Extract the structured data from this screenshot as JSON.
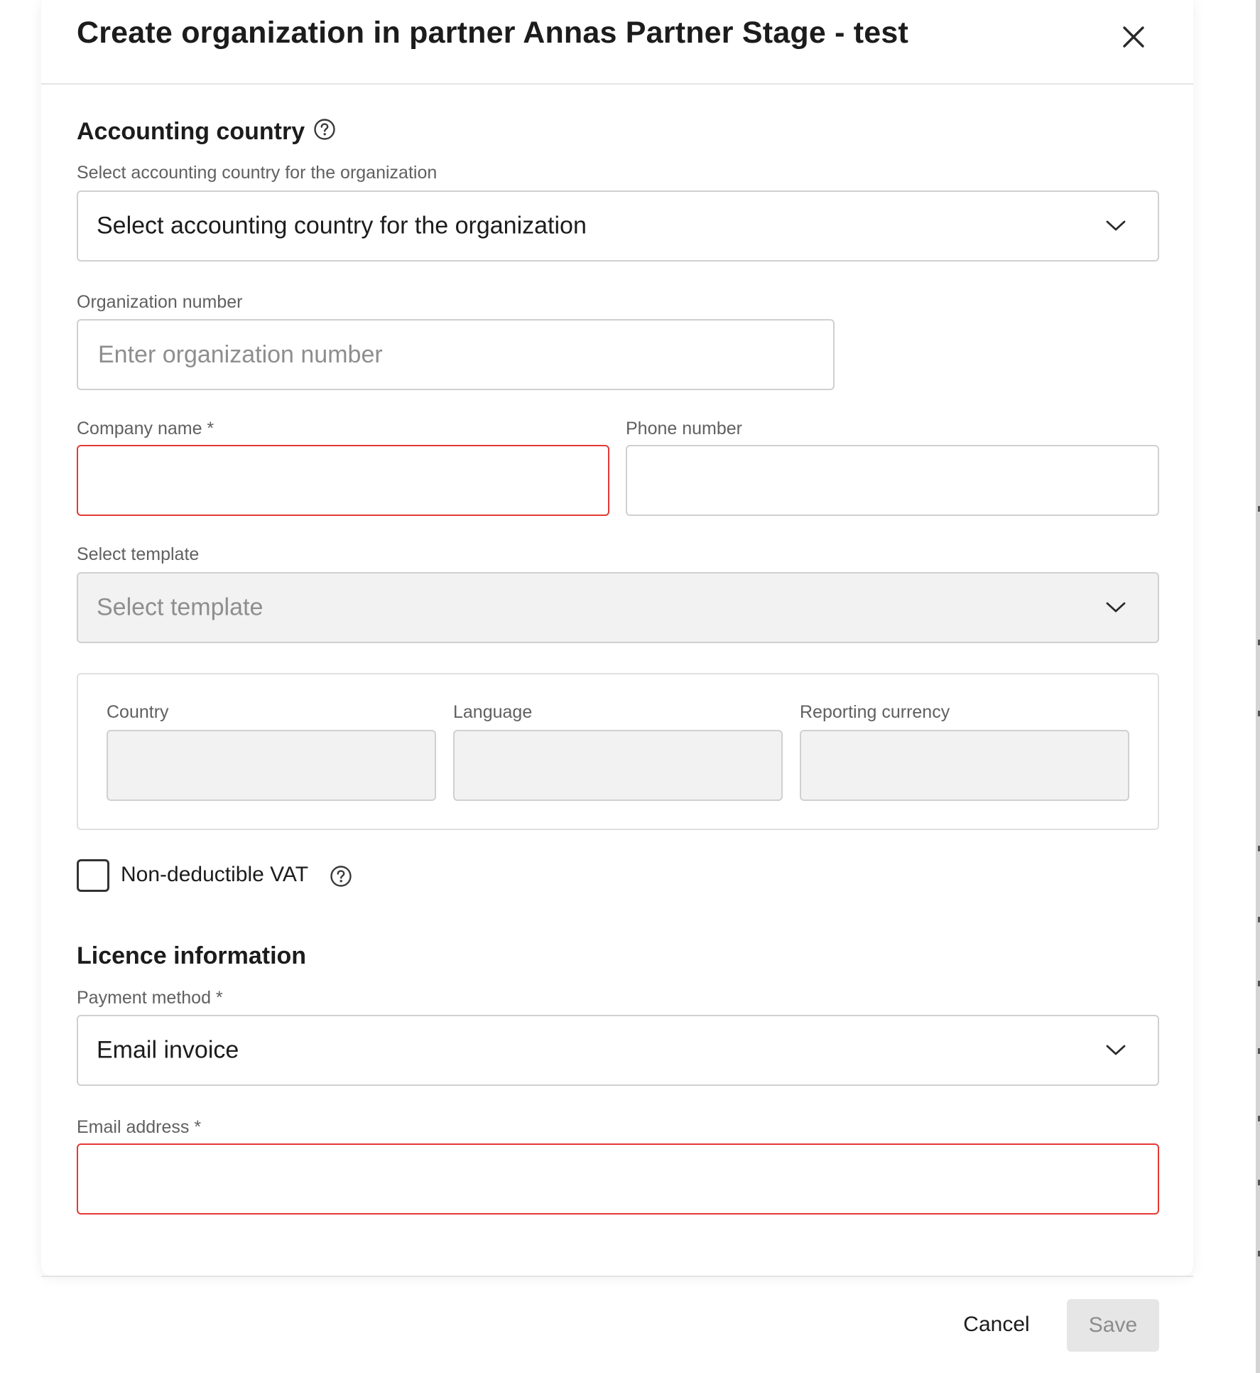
{
  "modal": {
    "title": "Create organization in partner Annas Partner Stage - test",
    "close_icon": "close-icon"
  },
  "accounting": {
    "section_title": "Accounting country",
    "help_icon": "help-circle-icon",
    "label": "Select accounting country for the organization",
    "select_value": "Select accounting country for the organization"
  },
  "org_number": {
    "label": "Organization number",
    "placeholder": "Enter organization number",
    "value": ""
  },
  "company_name": {
    "label": "Company name *",
    "value": "",
    "state": "error"
  },
  "phone_number": {
    "label": "Phone number",
    "value": ""
  },
  "template": {
    "label": "Select template",
    "placeholder": "Select template",
    "state": "disabled"
  },
  "template_details": {
    "country_label": "Country",
    "language_label": "Language",
    "currency_label": "Reporting currency"
  },
  "vat": {
    "label": "Non-deductible VAT",
    "checked": false
  },
  "licence": {
    "section_title": "Licence information",
    "payment_label": "Payment method *",
    "payment_value": "Email invoice",
    "email_label": "Email address *",
    "email_value": "",
    "email_state": "error"
  },
  "footer": {
    "cancel_label": "Cancel",
    "save_label": "Save"
  },
  "colors": {
    "error_border": "#e53935",
    "disabled_fill": "#f2f2f2",
    "text_primary": "#1c1c1c",
    "text_label": "#606060"
  }
}
